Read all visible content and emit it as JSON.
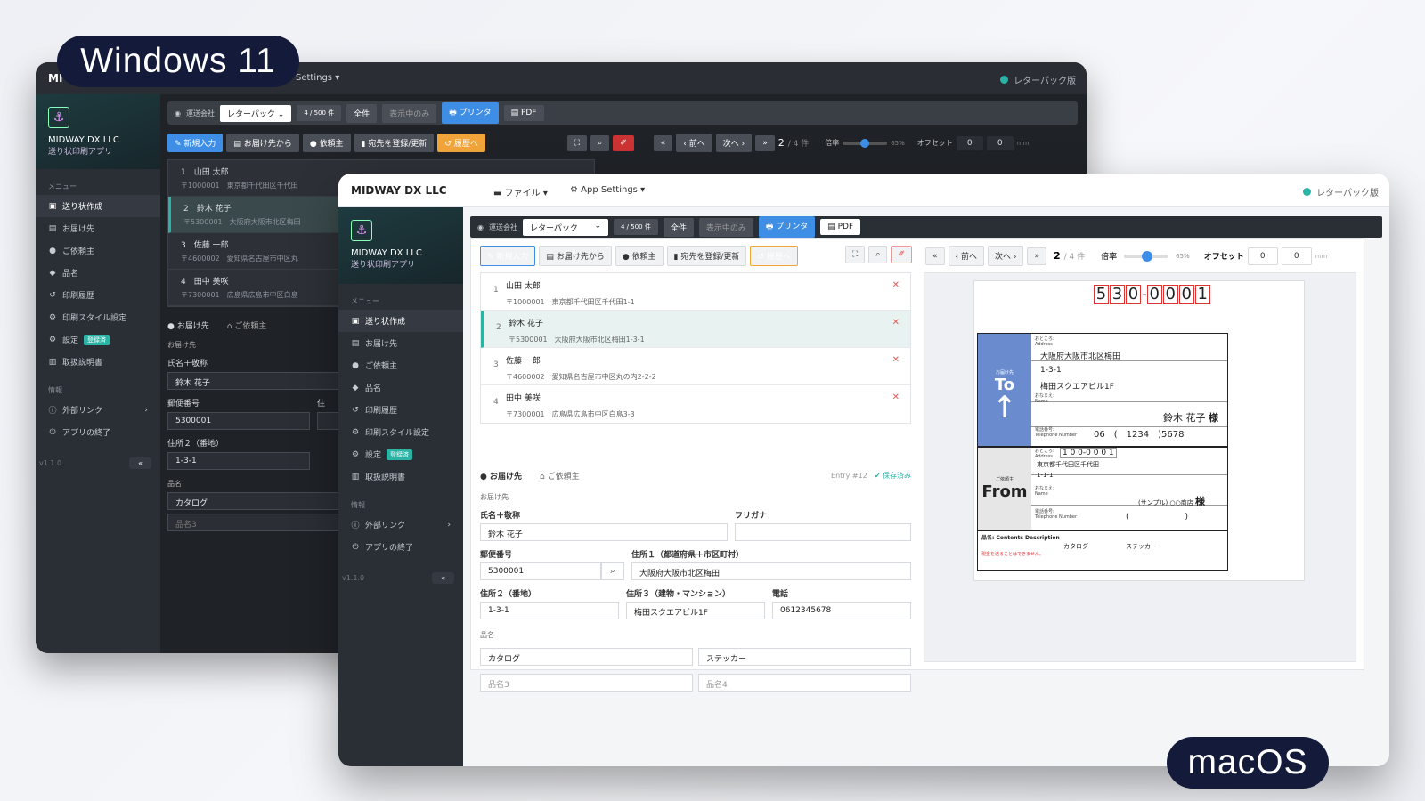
{
  "badges": {
    "windows": "Windows 11",
    "mac": "macOS"
  },
  "common": {
    "carrier_label": "運送会社",
    "carrier_value": "レターパック",
    "count": "4 / 500 件",
    "btn_all": "全件",
    "btn_shown": "表示中のみ",
    "btn_printer": "プリンタ",
    "btn_pdf": "PDF",
    "btn_new": "新規入力",
    "btn_from_dest": "お届け先から",
    "btn_client": "依頼主",
    "btn_register": "宛先を登録/更新",
    "btn_history": "履歴へ",
    "btn_first": "«",
    "btn_prev": "‹ 前へ",
    "btn_next": "次へ ›",
    "btn_last": "»",
    "page_current": "2",
    "page_total": "/ 4 件",
    "zoom_label": "倍率",
    "zoom_value": 65,
    "zoom_text": "65%",
    "offset_label": "オフセット",
    "offset_x": "0",
    "offset_y": "0",
    "offset_unit": "mm",
    "status_right": "レターパック版"
  },
  "sidebar": {
    "org": "MIDWAY DX LLC",
    "app": "送り状印刷アプリ",
    "menu_header": "メニュー",
    "items": [
      "送り状作成",
      "お届け先",
      "ご依頼主",
      "品名",
      "印刷履歴",
      "印刷スタイル設定",
      "設定",
      "取扱説明書"
    ],
    "settings_tag": "登録済",
    "info_header": "情報",
    "info_items": [
      "外部リンク",
      "アプリの終了"
    ],
    "version": "v1.1.0",
    "collapse": "«"
  },
  "win": {
    "brand": "MI",
    "menu": "Settings ▾"
  },
  "mac": {
    "brand": "MIDWAY DX LLC",
    "menu_file": "ファイル ▾",
    "menu_settings": "App Settings ▾"
  },
  "entries": [
    {
      "num": "1",
      "name": "山田 太郎",
      "zip": "〒1000001",
      "addr": "東京都千代田区千代田1-1"
    },
    {
      "num": "2",
      "name": "鈴木 花子",
      "zip": "〒5300001",
      "addr": "大阪府大阪市北区梅田1-3-1"
    },
    {
      "num": "3",
      "name": "佐藤 一郎",
      "zip": "〒4600002",
      "addr": "愛知県名古屋市中区丸の内2-2-2"
    },
    {
      "num": "4",
      "name": "田中 美咲",
      "zip": "〒7300001",
      "addr": "広島県広島市中区白島3-3"
    }
  ],
  "entries_win_addr": [
    "東京都千代田区千代田",
    "大阪府大阪市北区梅田",
    "愛知県名古屋市中区丸",
    "広島県広島市中区白島"
  ],
  "form": {
    "tab_dest": "お届け先",
    "tab_client": "ご依頼主",
    "entry": "Entry #12",
    "saved": "保存済み",
    "section": "お届け先",
    "name_label": "氏名＋敬称",
    "name_value": "鈴木 花子",
    "kana_label": "フリガナ",
    "zip_label": "郵便番号",
    "zip_value": "5300001",
    "addr1_label": "住所１（都道府県＋市区町村）",
    "addr1_value": "大阪府大阪市北区梅田",
    "addr2_label": "住所２（番地）",
    "addr2_value": "1-3-1",
    "addr3_label": "住所３（建物・マンション）",
    "addr3_value": "梅田スクエアビル1F",
    "tel_label": "電話",
    "tel_value": "0612345678",
    "item_label": "品名",
    "item1": "カタログ",
    "item2": "ステッカー",
    "item3_ph": "品名3",
    "item4_ph": "品名4",
    "win_addr1_label": "住",
    "win_addr2_label": "住所２（番地）"
  },
  "label": {
    "zip_digits": [
      "5",
      "3",
      "0",
      "0",
      "0",
      "0",
      "1"
    ],
    "to_small": "お届け先",
    "to": "To",
    "addr_small": "おところ:",
    "addr_en": "Address",
    "addr_line1": "大阪府大阪市北区梅田",
    "addr_line2": "1-3-1",
    "addr_line3": "梅田スクエアビル1F",
    "name_small": "おなまえ:",
    "name_en": "Name",
    "name_value": "鈴木 花子",
    "honorific": "様",
    "tel_small": "電話番号:",
    "tel_en": "Telephone Number",
    "tel_1": "06",
    "tel_2": "(",
    "tel_3": "1234",
    "tel_4": ")",
    "tel_5": "5678",
    "from_small": "ご依頼主",
    "from": "From",
    "from_zip": "1 0 0-0 0 0 1",
    "from_addr1": "東京都千代田区千代田",
    "from_addr2": "1-1-1",
    "from_name": "(サンプル) ○○商店",
    "from_tel_open": "(",
    "from_tel_close": ")",
    "contents": "品名: Contents Description",
    "contents_1": "カタログ",
    "contents_2": "ステッカー",
    "note_red": "現金を送ることはできません。"
  }
}
